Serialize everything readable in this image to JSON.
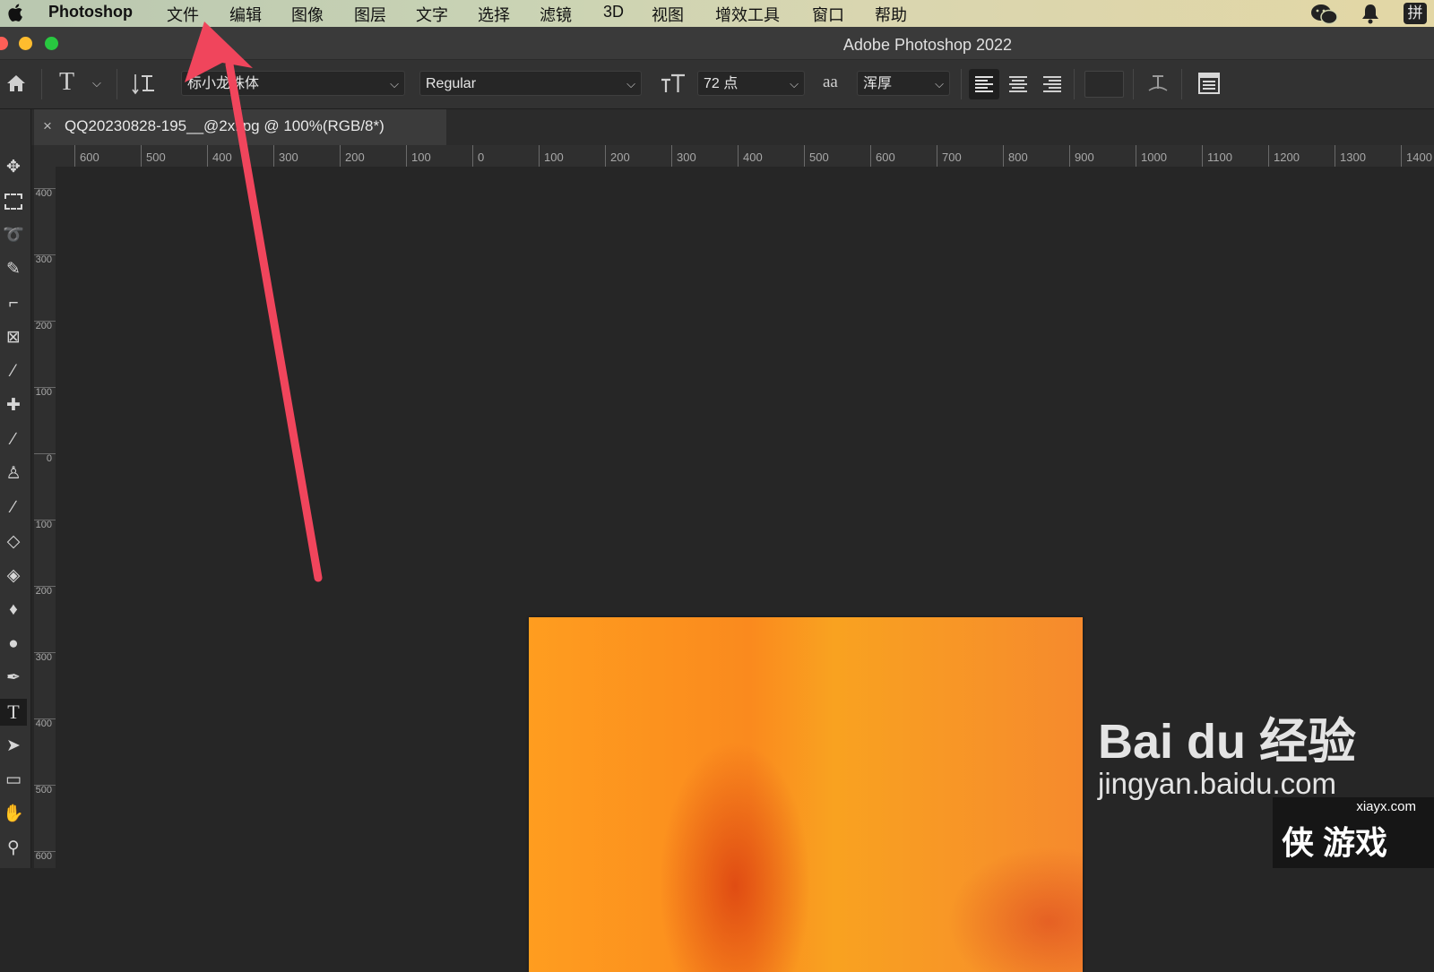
{
  "menubar": {
    "app_name": "Photoshop",
    "items": [
      "文件",
      "编辑",
      "图像",
      "图层",
      "文字",
      "选择",
      "滤镜",
      "3D",
      "视图",
      "增效工具",
      "窗口",
      "帮助"
    ],
    "status_icons": [
      "wechat-icon",
      "bell-icon",
      "input-method-icon"
    ],
    "input_method_label": "拼"
  },
  "window": {
    "title": "Adobe Photoshop 2022",
    "traffic_colors": [
      "#fe5f57",
      "#febc2e",
      "#28c840"
    ]
  },
  "options": {
    "font_family": "标小龙珠体",
    "font_style": "Regular",
    "font_size": "72 点",
    "antialias": "浑厚",
    "aa_glyph": "aa"
  },
  "document": {
    "tab_title": "QQ20230828-195__@2x.jpg @ 100%(RGB/8*)",
    "close_glyph": "×"
  },
  "rulers": {
    "horizontal_labels": [
      "600",
      "500",
      "400",
      "300",
      "200",
      "100",
      "0",
      "100",
      "200",
      "300",
      "400",
      "500",
      "600",
      "700",
      "800",
      "900",
      "1000",
      "1100",
      "1200",
      "1300",
      "1400"
    ],
    "vertical_labels": [
      "400",
      "300",
      "200",
      "100",
      "0",
      "100",
      "200",
      "300",
      "400",
      "500",
      "600"
    ]
  },
  "canvas": {
    "artboard_colors": [
      "#ff9d1f",
      "#fa8a1e",
      "#d8370f"
    ]
  },
  "annotation": {
    "arrow_color": "#f0455c",
    "points_to": "文件"
  },
  "watermarks": {
    "baidu_logo": "Bai du 经验",
    "baidu_url": "jingyan.baidu.com",
    "xiayx_url": "xiayx.com",
    "xiayx_logo": "侠 游戏"
  }
}
